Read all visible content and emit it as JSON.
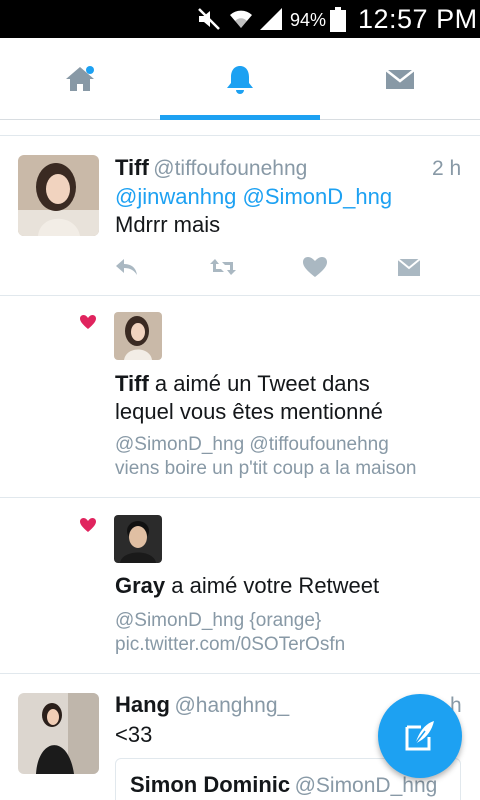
{
  "status_bar": {
    "battery_percent": "94%",
    "time": "12:57 PM",
    "icons": [
      "mute-icon",
      "wifi-icon",
      "signal-icon",
      "battery-icon"
    ]
  },
  "tabs": [
    {
      "name": "home",
      "icon": "home-icon",
      "active": false,
      "has_dot": true
    },
    {
      "name": "notifications",
      "icon": "bell-icon",
      "active": true
    },
    {
      "name": "messages",
      "icon": "envelope-icon",
      "active": false
    }
  ],
  "colors": {
    "accent": "#1da1f2",
    "like": "#e0245e",
    "muted": "#8899a6"
  },
  "tweet1": {
    "name": "Tiff",
    "handle": "@tiffoufounehng",
    "time": "2 h",
    "mention1": "@jinwanhng",
    "mention2": "@SimonD_hng",
    "text": "Mdrrr mais",
    "actions": [
      "reply-icon",
      "retweet-icon",
      "like-icon",
      "dm-icon"
    ]
  },
  "notif1": {
    "name": "Tiff",
    "action_text": " a aimé un Tweet dans",
    "action_text2": "lequel vous êtes mentionné",
    "tweet_line1": "@SimonD_hng @tiffoufounehng",
    "tweet_line2": "viens boire un p'tit coup a la maison"
  },
  "notif2": {
    "name": "Gray",
    "action_text": " a aimé votre Retweet",
    "tweet_line1": "@SimonD_hng {orange}",
    "tweet_line2": "pic.twitter.com/0SOTerOsfn"
  },
  "tweet2": {
    "name": "Hang",
    "handle": "@hanghng_",
    "time": "h",
    "text": "<33",
    "quote_name": "Simon Dominic",
    "quote_handle": "@SimonD_hng"
  },
  "fab": {
    "icon": "compose-icon"
  }
}
